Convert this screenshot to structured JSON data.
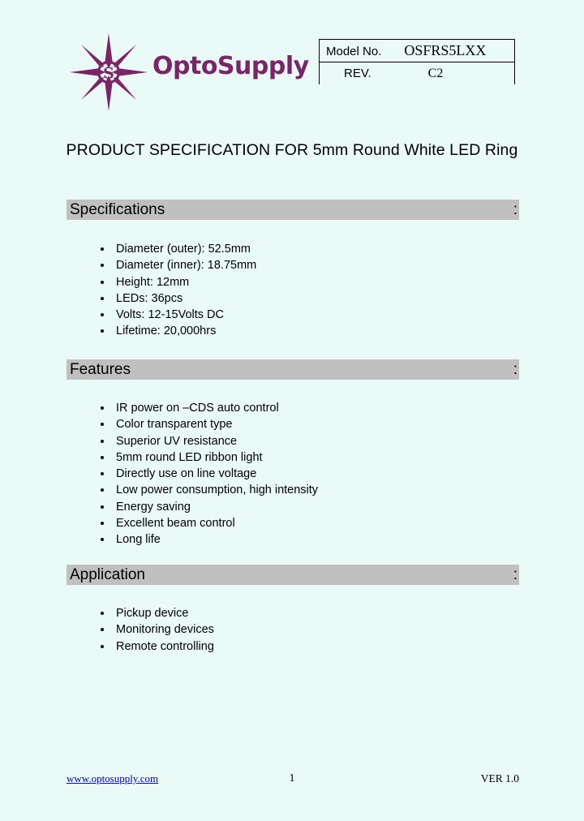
{
  "page": {
    "background_color": "#eafaf7",
    "section_bar_color": "#c0c0c0",
    "brand_color": "#7c2468",
    "link_color": "#0000cc"
  },
  "header": {
    "logo": {
      "icon": "compass-star-icon",
      "monogram": "S",
      "wordmark": "OptoSupply"
    },
    "model_table": {
      "model_label": "Model No.",
      "model_value": "OSFRS5LXX",
      "rev_label": "REV.",
      "rev_value": "C2"
    }
  },
  "document": {
    "title": "PRODUCT SPECIFICATION FOR 5mm Round White LED Ring"
  },
  "sections": [
    {
      "heading": "Specifications",
      "colon": ":",
      "items": [
        "Diameter (outer): 52.5mm",
        "Diameter (inner): 18.75mm",
        "Height: 12mm",
        "LEDs: 36pcs",
        "Volts: 12-15Volts DC",
        "Lifetime: 20,000hrs"
      ]
    },
    {
      "heading": "Features",
      "colon": ":",
      "items": [
        "IR power on –CDS auto control",
        "Color transparent type",
        "Superior UV resistance",
        "5mm round LED ribbon light",
        "Directly use on line voltage",
        "Low power consumption, high intensity",
        "Energy saving",
        "Excellent beam control",
        "Long life"
      ]
    },
    {
      "heading": "Application",
      "colon": ":",
      "items": [
        "Pickup device",
        "Monitoring devices",
        "Remote controlling"
      ]
    }
  ],
  "footer": {
    "url": "www.optosupply.com",
    "page_number": "1",
    "version": "VER 1.0"
  }
}
